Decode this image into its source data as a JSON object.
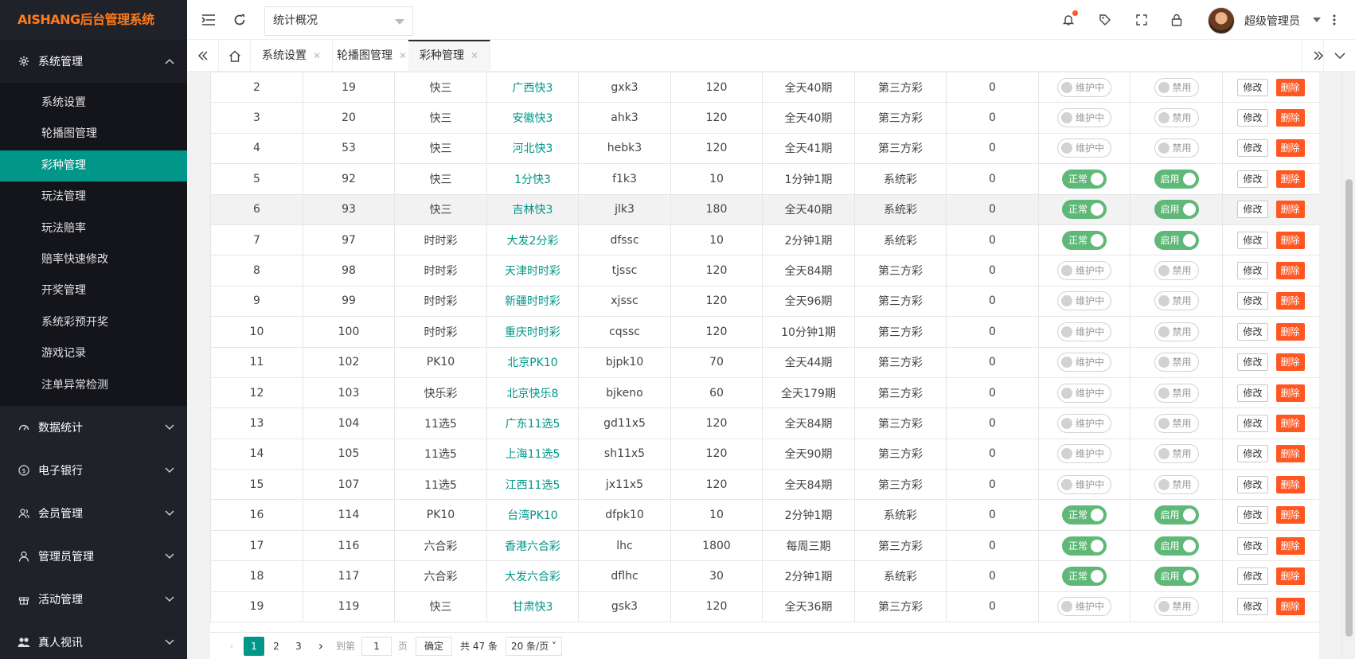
{
  "app": {
    "title": "AISHANG后台管理系统"
  },
  "sidebar": {
    "groups": [
      {
        "label": "系统管理",
        "icon": "gear-icon",
        "open": true,
        "items": [
          {
            "label": "系统设置",
            "active": false
          },
          {
            "label": "轮播图管理",
            "active": false
          },
          {
            "label": "彩种管理",
            "active": true
          },
          {
            "label": "玩法管理",
            "active": false
          },
          {
            "label": "玩法赔率",
            "active": false
          },
          {
            "label": "赔率快速修改",
            "active": false
          },
          {
            "label": "开奖管理",
            "active": false
          },
          {
            "label": "系统彩预开奖",
            "active": false
          },
          {
            "label": "游戏记录",
            "active": false
          },
          {
            "label": "注单异常检测",
            "active": false
          }
        ]
      },
      {
        "label": "数据统计",
        "icon": "dashboard-icon"
      },
      {
        "label": "电子银行",
        "icon": "dollar-circle-icon"
      },
      {
        "label": "会员管理",
        "icon": "users-icon"
      },
      {
        "label": "管理员管理",
        "icon": "user-icon"
      },
      {
        "label": "活动管理",
        "icon": "gift-icon"
      },
      {
        "label": "真人视讯",
        "icon": "group-icon"
      }
    ]
  },
  "header": {
    "select_value": "统计概况",
    "user_name": "超级管理员"
  },
  "tabs": [
    {
      "label": "系统设置",
      "active": false
    },
    {
      "label": "轮播图管理",
      "active": false
    },
    {
      "label": "彩种管理",
      "active": true
    }
  ],
  "table": {
    "rows": [
      {
        "no": "2",
        "id": "19",
        "type": "快三",
        "name": "广西快3",
        "code": "gxk3",
        "interval": "120",
        "periods": "全天40期",
        "source": "第三方彩",
        "count": "0",
        "status": "维护中",
        "status_on": false,
        "enable": "禁用",
        "enable_on": false
      },
      {
        "no": "3",
        "id": "20",
        "type": "快三",
        "name": "安徽快3",
        "code": "ahk3",
        "interval": "120",
        "periods": "全天40期",
        "source": "第三方彩",
        "count": "0",
        "status": "维护中",
        "status_on": false,
        "enable": "禁用",
        "enable_on": false
      },
      {
        "no": "4",
        "id": "53",
        "type": "快三",
        "name": "河北快3",
        "code": "hebk3",
        "interval": "120",
        "periods": "全天41期",
        "source": "第三方彩",
        "count": "0",
        "status": "维护中",
        "status_on": false,
        "enable": "禁用",
        "enable_on": false
      },
      {
        "no": "5",
        "id": "92",
        "type": "快三",
        "name": "1分快3",
        "code": "f1k3",
        "interval": "10",
        "periods": "1分钟1期",
        "source": "系统彩",
        "count": "0",
        "status": "正常",
        "status_on": true,
        "enable": "启用",
        "enable_on": true
      },
      {
        "no": "6",
        "id": "93",
        "type": "快三",
        "name": "吉林快3",
        "code": "jlk3",
        "interval": "180",
        "periods": "全天40期",
        "source": "系统彩",
        "count": "0",
        "status": "正常",
        "status_on": true,
        "enable": "启用",
        "enable_on": true
      },
      {
        "no": "7",
        "id": "97",
        "type": "时时彩",
        "name": "大发2分彩",
        "code": "dfssc",
        "interval": "10",
        "periods": "2分钟1期",
        "source": "系统彩",
        "count": "0",
        "status": "正常",
        "status_on": true,
        "enable": "启用",
        "enable_on": true
      },
      {
        "no": "8",
        "id": "98",
        "type": "时时彩",
        "name": "天津时时彩",
        "code": "tjssc",
        "interval": "120",
        "periods": "全天84期",
        "source": "第三方彩",
        "count": "0",
        "status": "维护中",
        "status_on": false,
        "enable": "禁用",
        "enable_on": false
      },
      {
        "no": "9",
        "id": "99",
        "type": "时时彩",
        "name": "新疆时时彩",
        "code": "xjssc",
        "interval": "120",
        "periods": "全天96期",
        "source": "第三方彩",
        "count": "0",
        "status": "维护中",
        "status_on": false,
        "enable": "禁用",
        "enable_on": false
      },
      {
        "no": "10",
        "id": "100",
        "type": "时时彩",
        "name": "重庆时时彩",
        "code": "cqssc",
        "interval": "120",
        "periods": "10分钟1期",
        "source": "第三方彩",
        "count": "0",
        "status": "维护中",
        "status_on": false,
        "enable": "禁用",
        "enable_on": false
      },
      {
        "no": "11",
        "id": "102",
        "type": "PK10",
        "name": "北京PK10",
        "code": "bjpk10",
        "interval": "70",
        "periods": "全天44期",
        "source": "第三方彩",
        "count": "0",
        "status": "维护中",
        "status_on": false,
        "enable": "禁用",
        "enable_on": false
      },
      {
        "no": "12",
        "id": "103",
        "type": "快乐彩",
        "name": "北京快乐8",
        "code": "bjkeno",
        "interval": "60",
        "periods": "全天179期",
        "source": "第三方彩",
        "count": "0",
        "status": "维护中",
        "status_on": false,
        "enable": "禁用",
        "enable_on": false
      },
      {
        "no": "13",
        "id": "104",
        "type": "11选5",
        "name": "广东11选5",
        "code": "gd11x5",
        "interval": "120",
        "periods": "全天84期",
        "source": "第三方彩",
        "count": "0",
        "status": "维护中",
        "status_on": false,
        "enable": "禁用",
        "enable_on": false
      },
      {
        "no": "14",
        "id": "105",
        "type": "11选5",
        "name": "上海11选5",
        "code": "sh11x5",
        "interval": "120",
        "periods": "全天90期",
        "source": "第三方彩",
        "count": "0",
        "status": "维护中",
        "status_on": false,
        "enable": "禁用",
        "enable_on": false
      },
      {
        "no": "15",
        "id": "107",
        "type": "11选5",
        "name": "江西11选5",
        "code": "jx11x5",
        "interval": "120",
        "periods": "全天84期",
        "source": "第三方彩",
        "count": "0",
        "status": "维护中",
        "status_on": false,
        "enable": "禁用",
        "enable_on": false
      },
      {
        "no": "16",
        "id": "114",
        "type": "PK10",
        "name": "台湾PK10",
        "code": "dfpk10",
        "interval": "10",
        "periods": "2分钟1期",
        "source": "系统彩",
        "count": "0",
        "status": "正常",
        "status_on": true,
        "enable": "启用",
        "enable_on": true
      },
      {
        "no": "17",
        "id": "116",
        "type": "六合彩",
        "name": "香港六合彩",
        "code": "lhc",
        "interval": "1800",
        "periods": "每周三期",
        "source": "第三方彩",
        "count": "0",
        "status": "正常",
        "status_on": true,
        "enable": "启用",
        "enable_on": true
      },
      {
        "no": "18",
        "id": "117",
        "type": "六合彩",
        "name": "大发六合彩",
        "code": "dflhc",
        "interval": "30",
        "periods": "2分钟1期",
        "source": "系统彩",
        "count": "0",
        "status": "正常",
        "status_on": true,
        "enable": "启用",
        "enable_on": true
      },
      {
        "no": "19",
        "id": "119",
        "type": "快三",
        "name": "甘肃快3",
        "code": "gsk3",
        "interval": "120",
        "periods": "全天36期",
        "source": "第三方彩",
        "count": "0",
        "status": "维护中",
        "status_on": false,
        "enable": "禁用",
        "enable_on": false
      }
    ],
    "highlight_row": 4,
    "edit_label": "修改",
    "delete_label": "删除"
  },
  "pager": {
    "pages": [
      "1",
      "2",
      "3"
    ],
    "current": "1",
    "goto_label": "到第",
    "goto_value": "1",
    "page_unit": "页",
    "confirm_label": "确定",
    "total_label": "共 47 条",
    "page_size": "20 条/页"
  },
  "colors": {
    "accent": "#009688",
    "sidebar_bg": "#20222a",
    "danger": "#ff5722",
    "switch_on": "#5fb878",
    "logo": "#ff7a1a"
  }
}
